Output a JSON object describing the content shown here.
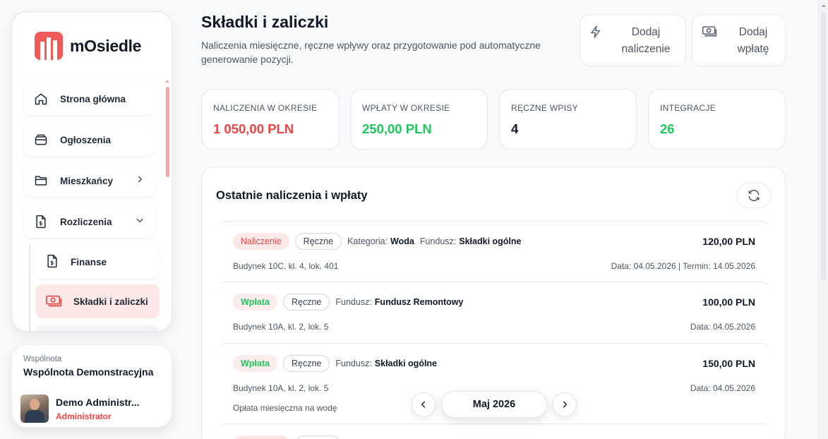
{
  "brand": {
    "name": "mOsiedle"
  },
  "sidebar": {
    "items": [
      {
        "label": "Strona główna",
        "icon": "home-icon"
      },
      {
        "label": "Ogłoszenia",
        "icon": "inbox-icon"
      },
      {
        "label": "Mieszkańcy",
        "icon": "folder-icon"
      },
      {
        "label": "Rozliczenia",
        "icon": "dollar-document-icon"
      }
    ],
    "subitems": [
      {
        "label": "Finanse",
        "icon": "dollar-document-icon"
      },
      {
        "label": "Składki i zaliczki",
        "icon": "banknote-icon",
        "active": true
      }
    ]
  },
  "community": {
    "label": "Wspólnota",
    "name": "Wspólnota Demonstracyjna",
    "user_name": "Demo Administr...",
    "user_role": "Administrator"
  },
  "page": {
    "title": "Składki i zaliczki",
    "subtitle": "Naliczenia miesięczne, ręczne wpływy oraz przygotowanie pod automatyczne generowanie pozycji."
  },
  "actions": {
    "add_charge": {
      "line1": "Dodaj",
      "line2": "naliczenie"
    },
    "add_payment": {
      "line1": "Dodaj",
      "line2": "wpłatę"
    }
  },
  "stats": [
    {
      "label": "NALICZENIA W OKRESIE",
      "value": "1 050,00 PLN",
      "color": "#ef4444"
    },
    {
      "label": "WPŁATY W OKRESIE",
      "value": "250,00 PLN",
      "color": "#22c55e"
    },
    {
      "label": "RĘCZNE WPISY",
      "value": "4",
      "color": "#111827"
    },
    {
      "label": "INTEGRACJE",
      "value": "26",
      "color": "#22c55e"
    }
  ],
  "panel": {
    "title": "Ostatnie naliczenia i wpłaty",
    "entries": [
      {
        "type": "Naliczenie",
        "source": "Ręczne",
        "category_label": "Kategoria:",
        "category": "Woda",
        "fund_label": "Fundusz:",
        "fund": "Składki ogólne",
        "amount": "120,00 PLN",
        "address": "Budynek 10C, kl. 4, lok. 401",
        "date": "Data: 04.05.2026 | Termin: 14.05.2026",
        "note": ""
      },
      {
        "type": "Wpłata",
        "source": "Ręczne",
        "category_label": "",
        "category": "",
        "fund_label": "Fundusz:",
        "fund": "Fundusz Remontowy",
        "amount": "100,00 PLN",
        "address": "Budynek 10A, kl. 2, lok. 5",
        "date": "Data: 04.05.2026",
        "note": ""
      },
      {
        "type": "Wpłata",
        "source": "Ręczne",
        "category_label": "",
        "category": "",
        "fund_label": "Fundusz:",
        "fund": "Składki ogólne",
        "amount": "150,00 PLN",
        "address": "Budynek 10A, kl. 2, lok. 5",
        "date": "Data: 04.05.2026",
        "note": "Opłata miesięczna na wodę"
      }
    ]
  },
  "month_picker": {
    "label": "Maj 2026"
  }
}
